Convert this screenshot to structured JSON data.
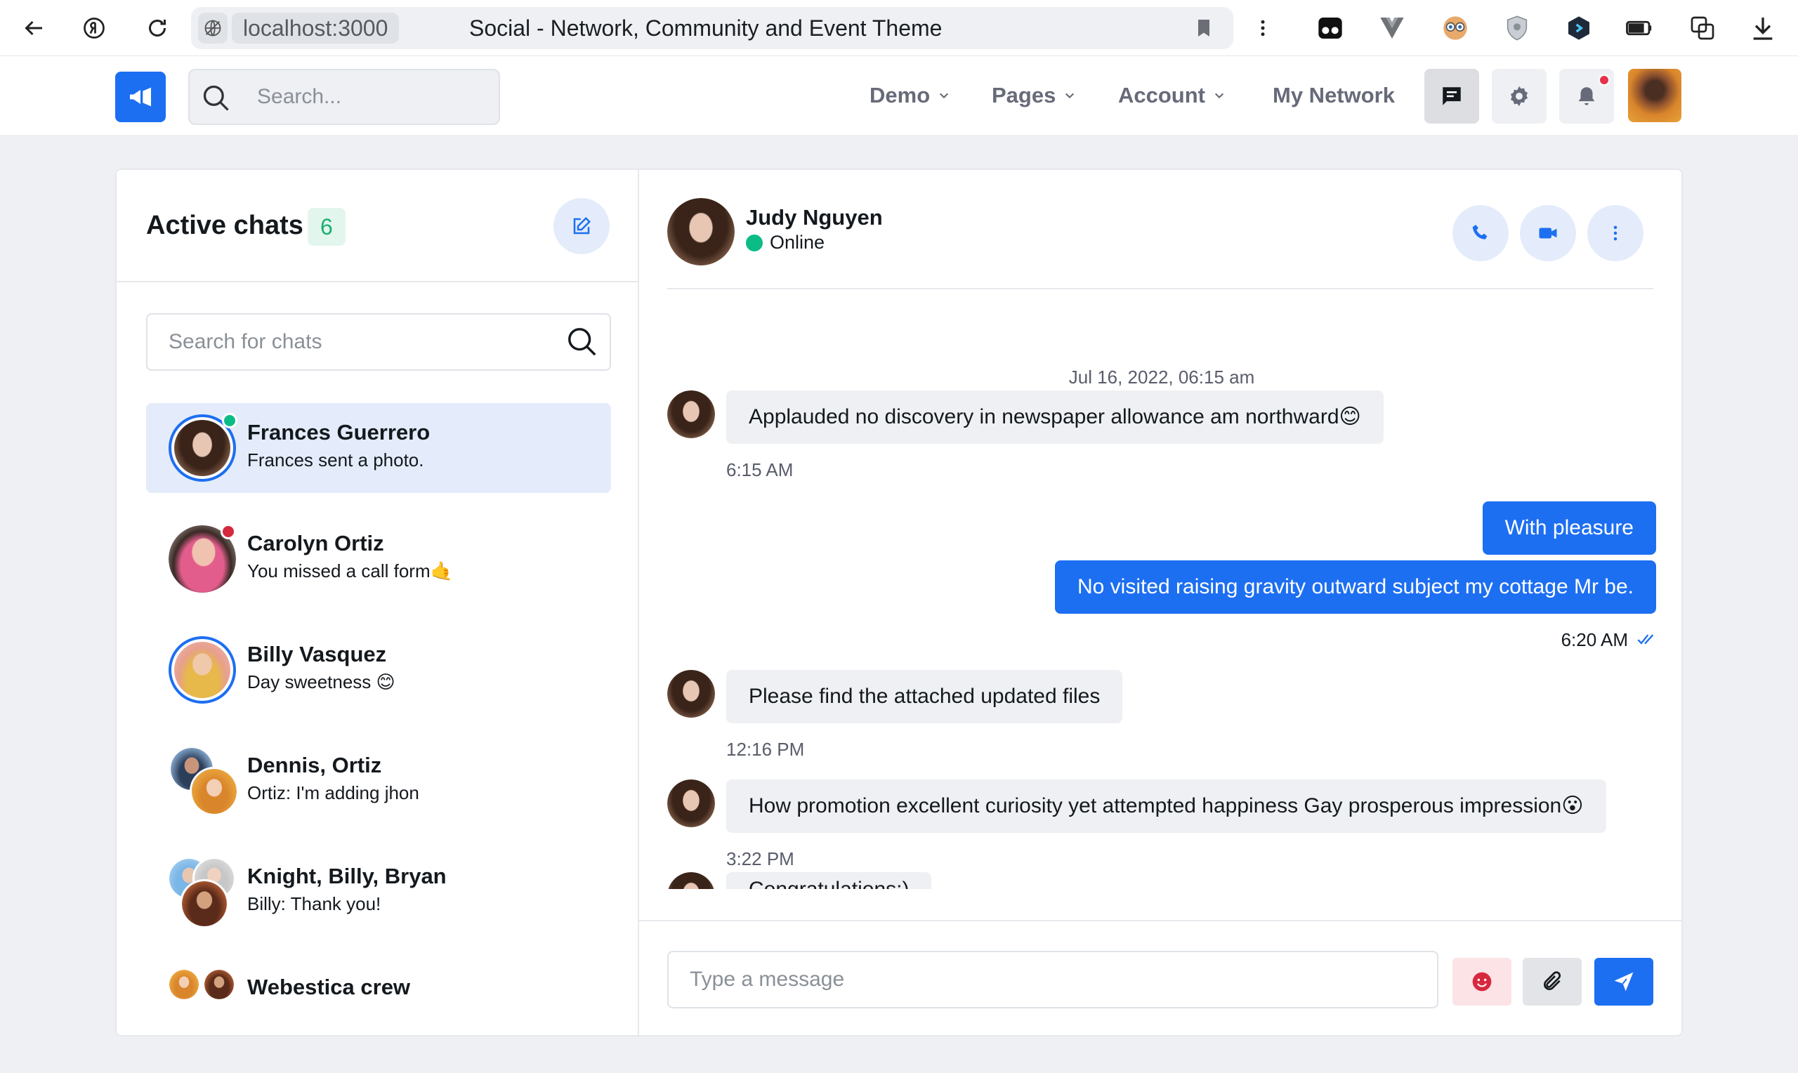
{
  "browser": {
    "host": "localhost:3000",
    "tab_title": "Social - Network, Community and Event Theme"
  },
  "navbar": {
    "search_placeholder": "Search...",
    "menu": [
      {
        "label": "Demo",
        "has_dropdown": true
      },
      {
        "label": "Pages",
        "has_dropdown": true
      },
      {
        "label": "Account",
        "has_dropdown": true
      },
      {
        "label": "My Network",
        "has_dropdown": false
      }
    ],
    "icons": [
      "chat-icon",
      "gear-icon",
      "bell-icon"
    ],
    "notification_dot": true
  },
  "chats": {
    "title": "Active chats",
    "count": "6",
    "search_placeholder": "Search for chats",
    "items": [
      {
        "name": "Frances Guerrero",
        "preview": "Frances sent a photo.",
        "status": "online",
        "active": true
      },
      {
        "name": "Carolyn Ortiz",
        "preview": "You missed a call form🤙",
        "status": "busy",
        "active": false
      },
      {
        "name": "Billy Vasquez",
        "preview": "Day sweetness 😊",
        "status": "story",
        "active": false
      },
      {
        "name": "Dennis, Ortiz",
        "preview": "Ortiz: I'm adding jhon",
        "status": "group",
        "active": false
      },
      {
        "name": "Knight, Billy, Bryan",
        "preview": "Billy: Thank you!",
        "status": "group",
        "active": false
      },
      {
        "name": "Webestica crew",
        "preview": "",
        "status": "group",
        "active": false
      }
    ]
  },
  "conversation": {
    "contact_name": "Judy Nguyen",
    "contact_status": "Online",
    "date": "Jul 16, 2022, 06:15 am",
    "messages": [
      {
        "direction": "in",
        "text": "Applauded no discovery in newspaper allowance am northward😊",
        "time": "6:15 AM"
      },
      {
        "direction": "out",
        "text": "With pleasure",
        "time": ""
      },
      {
        "direction": "out",
        "text": "No visited raising gravity outward subject my cottage Mr be.",
        "time": "6:20 AM"
      },
      {
        "direction": "in",
        "text": "Please find the attached updated files",
        "time": "12:16 PM"
      },
      {
        "direction": "in",
        "text": "How promotion excellent curiosity yet attempted happiness Gay prosperous impression😮",
        "time": "3:22 PM"
      },
      {
        "direction": "in",
        "text": "Congratulations:)",
        "time": ""
      }
    ],
    "compose_placeholder": "Type a message"
  },
  "colors": {
    "primary": "#1d6ff2",
    "success": "#0cbc87",
    "danger": "#d6293e",
    "background": "#eef0f4"
  }
}
